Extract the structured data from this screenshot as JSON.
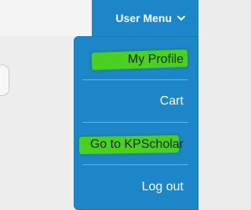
{
  "header": {
    "user_menu_label": "User Menu"
  },
  "menu": {
    "items": [
      {
        "label": "My Profile"
      },
      {
        "label": "Cart"
      },
      {
        "label": "Go to KPScholar"
      },
      {
        "label": "Log out"
      }
    ]
  },
  "colors": {
    "menu_blue": "#1d86c9",
    "highlight_green": "#4bd01f",
    "text_white": "#ffffff"
  }
}
